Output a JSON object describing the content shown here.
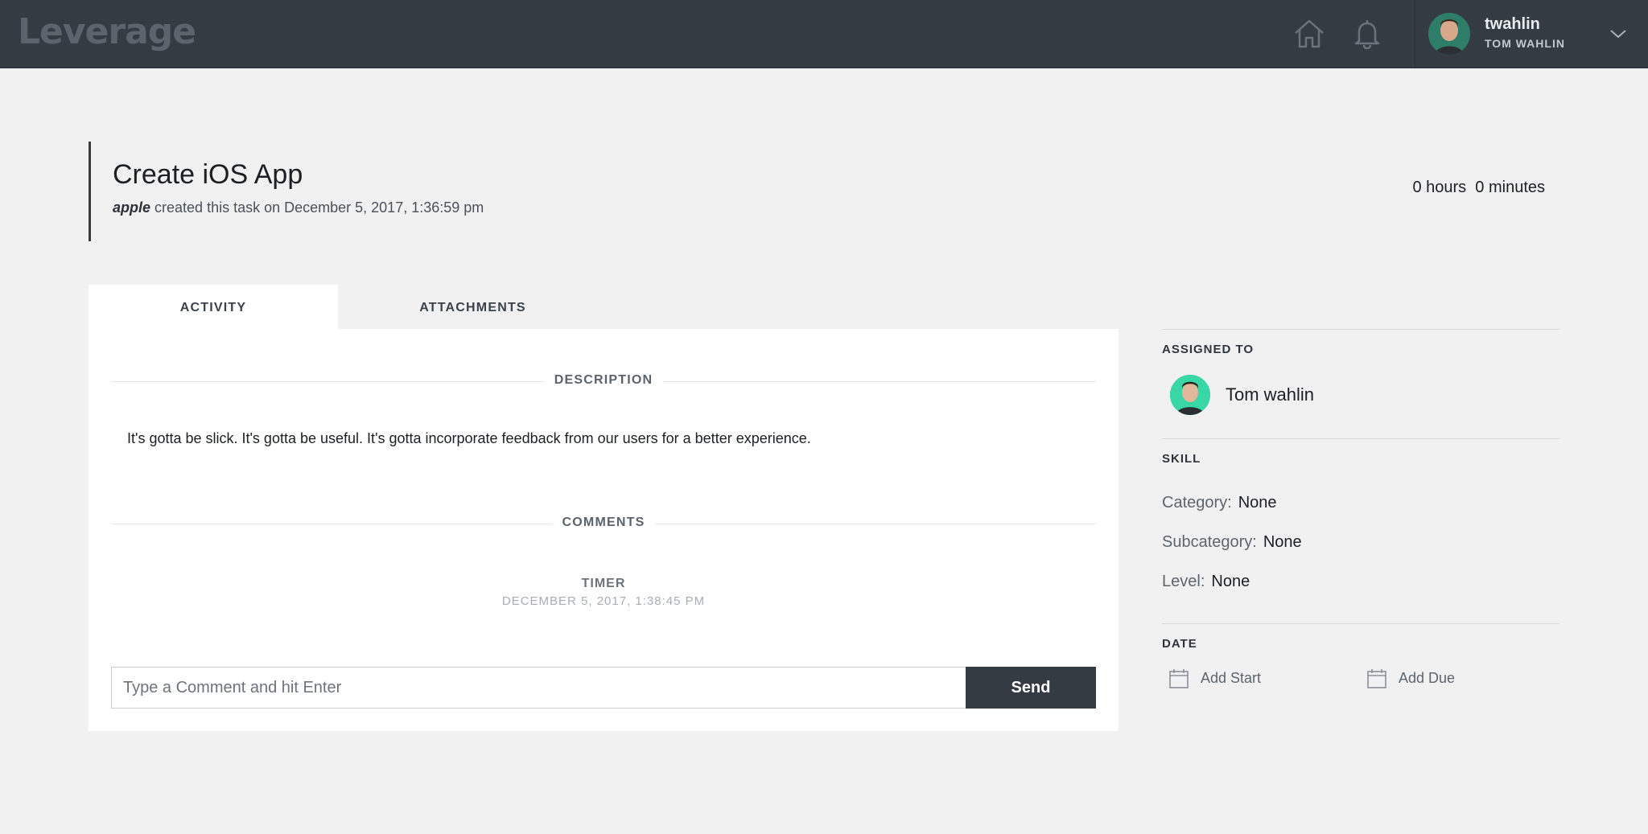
{
  "app": {
    "logo": "Leverage"
  },
  "user": {
    "handle": "twahlin",
    "full_name": "TOM WAHLIN"
  },
  "nav": {
    "icons": [
      "home-icon",
      "bell-icon",
      "chevron-down-icon"
    ]
  },
  "task": {
    "title": "Create iOS App",
    "creator": "apple",
    "created_text": "created this task on December 5, 2017, 1:36:59 pm",
    "time_spent": "0 hours  0 minutes"
  },
  "tabs": [
    {
      "label": "ACTIVITY",
      "active": true
    },
    {
      "label": "ATTACHMENTS",
      "active": false
    }
  ],
  "activity": {
    "description_heading": "DESCRIPTION",
    "description": "It's gotta be slick. It's gotta be useful. It's gotta incorporate feedback from our users for a better experience.",
    "comments_heading": "COMMENTS",
    "timer_label": "TIMER",
    "timer_date": "DECEMBER 5, 2017, 1:38:45 PM",
    "comment_placeholder": "Type a Comment and hit Enter",
    "comment_value": "",
    "send_label": "Send"
  },
  "sidebar": {
    "assigned_heading": "ASSIGNED TO",
    "assignee": "Tom wahlin",
    "skill_heading": "SKILL",
    "category_label": "Category:",
    "category_value": "None",
    "subcategory_label": "Subcategory:",
    "subcategory_value": "None",
    "level_label": "Level:",
    "level_value": "None",
    "date_heading": "DATE",
    "add_start": "Add Start",
    "add_due": "Add Due"
  },
  "colors": {
    "topbar": "#343b43",
    "background": "#f1f1f1",
    "accent_avatar": "#39d6a6",
    "button": "#343b43"
  }
}
